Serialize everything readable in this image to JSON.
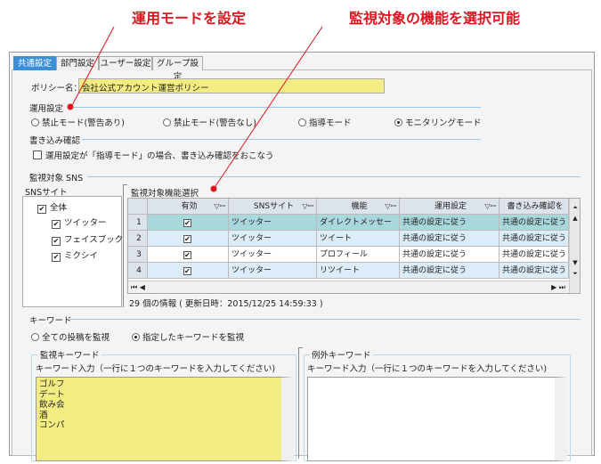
{
  "annotations": {
    "left": "運用モードを設定",
    "right": "監視対象の機能を選択可能",
    "color": "#e0141e"
  },
  "tabs": [
    {
      "label": "共通設定",
      "selected": true
    },
    {
      "label": "部門設定"
    },
    {
      "label": "ユーザー設定"
    },
    {
      "label": "グループ設定"
    }
  ],
  "policy": {
    "label": "ポリシー名：",
    "value": "会社公式アカウント運営ポリシー"
  },
  "mode": {
    "title": "運用設定",
    "options": [
      "禁止モード(警告あり)",
      "禁止モード(警告なし)",
      "指導モード",
      "モニタリングモード"
    ],
    "selected": 3
  },
  "write_confirm": {
    "title": "書き込み確認",
    "checkbox": "運用設定が「指導モード」の場合、書き込み確認をおこなう",
    "checked": false
  },
  "sns": {
    "title": "監視対象 SNS",
    "site_label": "SNSサイト",
    "tree": [
      {
        "label": "全体",
        "checked": true
      },
      {
        "label": "ツイッター",
        "checked": true
      },
      {
        "label": "フェイスブック",
        "checked": true
      },
      {
        "label": "ミクシイ",
        "checked": true
      }
    ]
  },
  "features": {
    "title": "監視対象機能選択",
    "columns": [
      "有効",
      "SNSサイト",
      "機能",
      "運用設定",
      "書き込み確認を"
    ],
    "rows": [
      {
        "n": "1",
        "enabled": true,
        "site": "ツイッター",
        "feature": "ダイレクトメッセージ",
        "mode": "共通の設定に従う",
        "confirm": "共通の設定に従う"
      },
      {
        "n": "2",
        "enabled": true,
        "site": "ツイッター",
        "feature": "ツイート",
        "mode": "共通の設定に従う",
        "confirm": "共通の設定に従う"
      },
      {
        "n": "3",
        "enabled": true,
        "site": "ツイッター",
        "feature": "プロフィール",
        "mode": "共通の設定に従う",
        "confirm": "共通の設定に従う"
      },
      {
        "n": "4",
        "enabled": true,
        "site": "ツイッター",
        "feature": "リツイート",
        "mode": "共通の設定に従う",
        "confirm": "共通の設定に従う"
      }
    ],
    "status": "29 個の情報 ( 更新日時：2015/12/25 14:59:33 )"
  },
  "keyword": {
    "title": "キーワード",
    "options": [
      "全ての投稿を監視",
      "指定したキーワードを監視"
    ],
    "selected": 1,
    "monitor": {
      "title": "監視キーワード",
      "label": "キーワード入力（一行に１つのキーワードを入力してください)",
      "values": [
        "ゴルフ",
        "デート",
        "飲み会",
        "酒",
        "コンパ"
      ]
    },
    "exclude": {
      "title": "例外キーワード",
      "label": "キーワード入力（一行に１つのキーワードを入力してください)",
      "values": []
    }
  }
}
